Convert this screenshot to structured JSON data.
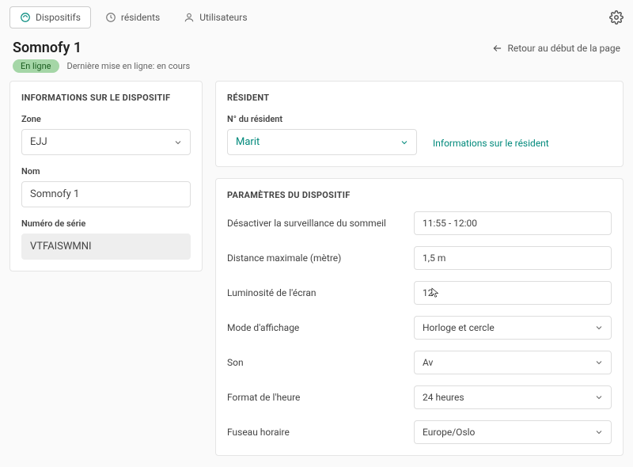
{
  "tabs": [
    {
      "label": "Dispositifs",
      "icon": "devices"
    },
    {
      "label": "résidents",
      "icon": "clock"
    },
    {
      "label": "Utilisateurs",
      "icon": "user"
    }
  ],
  "title": "Somnofy 1",
  "back_link": "Retour au début de la page",
  "status_badge": "En ligne",
  "status_text": "Dernière mise en ligne: en cours",
  "device_info": {
    "title": "INFORMATIONS SUR LE DISPOSITIF",
    "zone_label": "Zone",
    "zone_value": "EJJ",
    "name_label": "Nom",
    "name_value": "Somnofy 1",
    "serial_label": "Numéro de série",
    "serial_value": "VTFAISWMNI"
  },
  "resident": {
    "title": "RÉSIDENT",
    "number_label": "N° du résident",
    "number_value": "Marit",
    "info_link": "Informations sur le résident"
  },
  "settings": {
    "title": "PARAMÈTRES DU DISPOSITIF",
    "rows": [
      {
        "label": "Désactiver la surveillance du sommeil",
        "value": "11:55 - 12:00",
        "type": "text"
      },
      {
        "label": "Distance maximale (mètre)",
        "value": "1,5 m",
        "type": "text"
      },
      {
        "label": "Luminosité de l'écran",
        "value": "12",
        "type": "text"
      },
      {
        "label": "Mode d'affichage",
        "value": "Horloge et cercle",
        "type": "select"
      },
      {
        "label": "Son",
        "value": "Av",
        "type": "select"
      },
      {
        "label": "Format de l'heure",
        "value": "24 heures",
        "type": "select"
      },
      {
        "label": "Fuseau horaire",
        "value": "Europe/Oslo",
        "type": "select"
      }
    ]
  }
}
